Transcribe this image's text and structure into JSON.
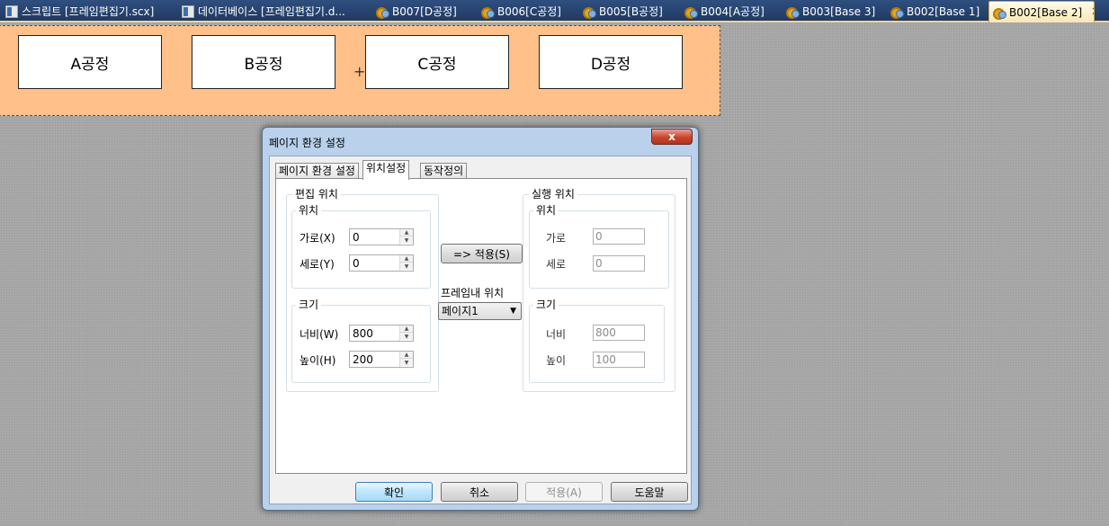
{
  "tabs": [
    {
      "label": "스크립트 [프레임편집기.scx]",
      "icon": "document-icon"
    },
    {
      "label": "데이터베이스 [프레임편집기.d...",
      "icon": "document-icon"
    },
    {
      "label": "B007[D공정]",
      "icon": "gear-icon"
    },
    {
      "label": "B006[C공정]",
      "icon": "gear-icon"
    },
    {
      "label": "B005[B공정]",
      "icon": "gear-icon"
    },
    {
      "label": "B004[A공정]",
      "icon": "gear-icon"
    },
    {
      "label": "B003[Base 3]",
      "icon": "gear-icon"
    },
    {
      "label": "B002[Base 1]",
      "icon": "gear-icon"
    },
    {
      "label": "B002[Base 2]",
      "icon": "gear-icon",
      "active": true,
      "close": "✕"
    }
  ],
  "canvas": {
    "background": "#ffc08a",
    "boxes": [
      "A공정",
      "B공정",
      "C공정",
      "D공정"
    ],
    "crosshair": "+"
  },
  "dialog": {
    "title": "페이지 환경 설정",
    "close": "x",
    "tabs": [
      "페이지 환경 설정",
      "위치설정",
      "동작정의"
    ],
    "selected_tab": "위치설정",
    "edit": {
      "group": "편집 위치",
      "position": {
        "group": "위치",
        "x_label": "가로(X)",
        "x_value": "0",
        "y_label": "세로(Y)",
        "y_value": "0"
      },
      "size": {
        "group": "크기",
        "w_label": "너비(W)",
        "w_value": "800",
        "h_label": "높이(H)",
        "h_value": "200"
      }
    },
    "apply_arrow": "=> 적용(S)",
    "frame_position": {
      "label": "프레임내 위치",
      "selected": "페이지1"
    },
    "runtime": {
      "group": "실행 위치",
      "position": {
        "group": "위치",
        "x_label": "가로",
        "x_value": "0",
        "y_label": "세로",
        "y_value": "0"
      },
      "size": {
        "group": "크기",
        "w_label": "너비",
        "w_value": "800",
        "h_label": "높이",
        "h_value": "100"
      }
    },
    "buttons": {
      "ok": "확인",
      "cancel": "취소",
      "apply": "적용(A)",
      "help": "도움말"
    }
  }
}
